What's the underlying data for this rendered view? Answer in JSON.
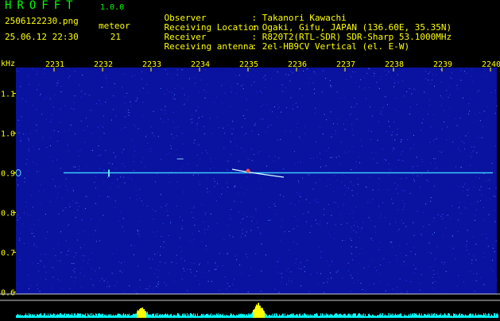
{
  "header": {
    "app_name": "HROFFT",
    "app_version": "1.0.0",
    "filename": "2506122230.png",
    "datetime": "25.06.12 22:30",
    "meteor_label": "meteor",
    "meteor_count": "21",
    "info": [
      {
        "label": "Observer",
        "value": ": Takanori Kawachi"
      },
      {
        "label": "Receiving Location",
        "value": ": Ogaki, Gifu, JAPAN (136.60E, 35.35N)"
      },
      {
        "label": "Receiver",
        "value": ": R820T2(RTL-SDR) SDR-Sharp 53.1000MHz"
      },
      {
        "label": "Receiving antenna",
        "value": ": 2el-HB9CV Vertical (el. E-W)"
      }
    ]
  },
  "colors": {
    "background": "#000000",
    "header_text": "#ffff00",
    "title_text": "#00ff00",
    "waterfall_base": "#0a12a0",
    "carrier_line": "#3cc8ff",
    "level_bars": "#00ffff",
    "level_peak": "#ffff00",
    "tick_text": "#ffff00"
  },
  "chart_data": {
    "type": "heatmap",
    "x_unit_label": "",
    "y_unit_label": "kHz",
    "x_ticks": [
      "2231",
      "2232",
      "2233",
      "2234",
      "2235",
      "2236",
      "2237",
      "2238",
      "2239",
      "2240"
    ],
    "y_ticks": [
      "1.1",
      "1.0",
      "0.9",
      "0.8",
      "0.7",
      "0.6"
    ],
    "y_tick_values": [
      1.1,
      1.0,
      0.9,
      0.8,
      0.7,
      0.6
    ],
    "ylim": [
      0.595,
      1.165
    ],
    "carrier_khz": 0.9,
    "meteor_echoes": [
      {
        "time": "2235",
        "freq_khz": 0.905
      },
      {
        "time": "2233.6",
        "freq_khz": 0.935
      }
    ],
    "level_peaks": [
      {
        "time": "2232.8",
        "level": 0.55
      },
      {
        "time": "2235.2",
        "level": 0.8
      }
    ]
  }
}
